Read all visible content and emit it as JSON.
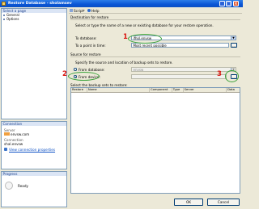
{
  "window": {
    "title": "Restore Database - sholamsev",
    "controls": {
      "min": "_",
      "max": "□",
      "close": "×"
    }
  },
  "nav": {
    "header": "Select a page",
    "items": [
      {
        "label": "General"
      },
      {
        "label": "Options"
      }
    ]
  },
  "toolbar": {
    "script_label": "Script",
    "help_label": "Help"
  },
  "destination": {
    "section_title": "Destination for restore",
    "instruction": "Select or type the name of a new or existing database for your restore operation.",
    "to_database_label": "To database:",
    "to_database_value": "ifhol.envsw",
    "point_in_time_label": "To a point in time:",
    "point_in_time_value": "Most recent possible",
    "ellipsis": "..."
  },
  "source": {
    "section_title": "Source for restore",
    "instruction": "Specify the source and location of backup sets to restore.",
    "from_database_label": "From database:",
    "from_database_value": "envsw",
    "from_device_label": "From device:",
    "from_device_value": "",
    "browse_label": "...",
    "backup_sets_label": "Select the backup sets to restore:",
    "columns": [
      "Restore",
      "Name",
      "Component",
      "Type",
      "Server",
      "Data"
    ]
  },
  "connection": {
    "header": "Connection",
    "server_label": "Server",
    "server_value": "envsw.com",
    "connection_label": "Connection",
    "connection_value": "shal.envsw",
    "link_label": "View connection properties"
  },
  "progress": {
    "header": "Progress",
    "status": "Ready"
  },
  "markers": {
    "one": "1",
    "two": "2",
    "three": "3"
  },
  "buttons": {
    "ok": "OK",
    "cancel": "Cancel"
  },
  "colors": {
    "title_bar": "#0b4fc4",
    "highlight_circle": "#3aa33a",
    "marker": "#d9140f"
  }
}
